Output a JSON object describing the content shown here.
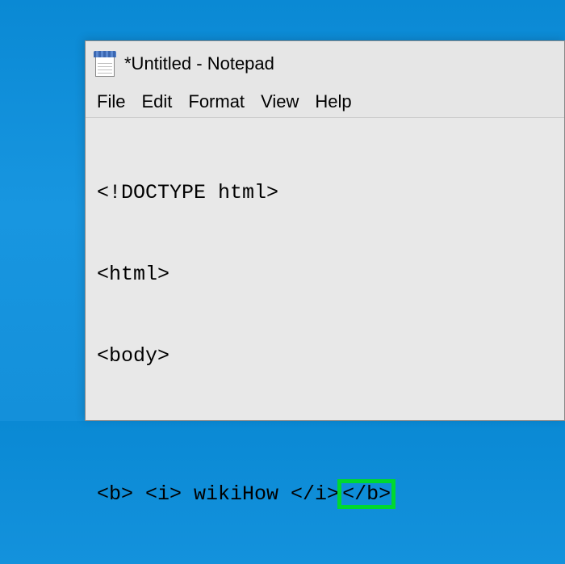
{
  "window": {
    "title": "*Untitled - Notepad"
  },
  "menubar": {
    "items": [
      "File",
      "Edit",
      "Format",
      "View",
      "Help"
    ]
  },
  "content": {
    "line1": "<!DOCTYPE html>",
    "line2": "<html>",
    "line3": "<body>",
    "line4": "",
    "line5_part1": "<b> <i> wikiHow </i>",
    "line5_highlight": "</b>"
  }
}
